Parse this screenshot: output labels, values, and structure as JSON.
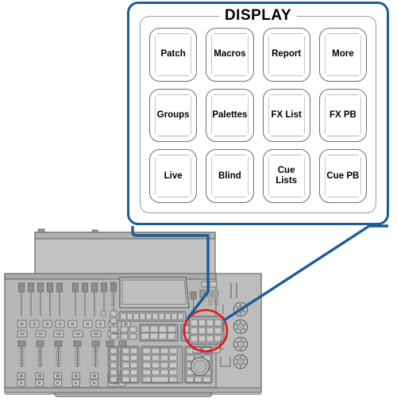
{
  "callout": {
    "title": "DISPLAY",
    "border_color": "#1d5b96",
    "keys": [
      {
        "label": "Patch"
      },
      {
        "label": "Macros"
      },
      {
        "label": "Report"
      },
      {
        "label": "More"
      },
      {
        "label": "Groups"
      },
      {
        "label": "Palettes"
      },
      {
        "label": "FX List"
      },
      {
        "label": "FX PB"
      },
      {
        "label": "Live"
      },
      {
        "label": "Blind"
      },
      {
        "label": "Cue\nLists"
      },
      {
        "label": "Cue PB"
      }
    ]
  },
  "console": {
    "highlight_color": "#e8151c",
    "leader_color": "#1d5b96",
    "body_color": "#b7b7b7",
    "detail_color": "#808080"
  }
}
